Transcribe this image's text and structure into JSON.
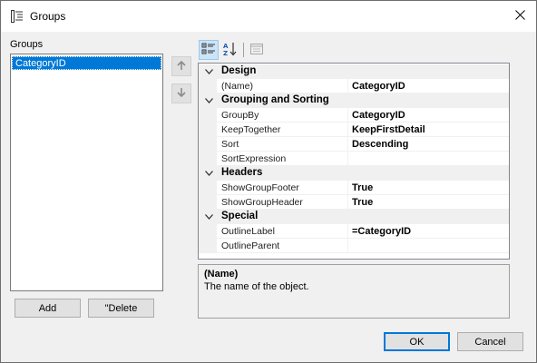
{
  "window": {
    "title": "Groups"
  },
  "groups_panel": {
    "label": "Groups",
    "items": [
      "CategoryID"
    ]
  },
  "buttons": {
    "add": "Add",
    "delete": "\"Delete",
    "ok": "OK",
    "cancel": "Cancel"
  },
  "property_grid": {
    "categories": [
      {
        "name": "Design",
        "properties": [
          {
            "name": "(Name)",
            "value": "CategoryID"
          }
        ]
      },
      {
        "name": "Grouping and Sorting",
        "properties": [
          {
            "name": "GroupBy",
            "value": "CategoryID"
          },
          {
            "name": "KeepTogether",
            "value": "KeepFirstDetail"
          },
          {
            "name": "Sort",
            "value": "Descending"
          },
          {
            "name": "SortExpression",
            "value": ""
          }
        ]
      },
      {
        "name": "Headers",
        "properties": [
          {
            "name": "ShowGroupFooter",
            "value": "True"
          },
          {
            "name": "ShowGroupHeader",
            "value": "True"
          }
        ]
      },
      {
        "name": "Special",
        "properties": [
          {
            "name": "OutlineLabel",
            "value": "=CategoryID"
          },
          {
            "name": "OutlineParent",
            "value": ""
          }
        ]
      }
    ]
  },
  "description": {
    "title": "(Name)",
    "text": "The name of the object."
  },
  "colors": {
    "selection": "#0078d7",
    "window_bg": "#f0f0f0"
  },
  "icons": {
    "title": "groups-icon",
    "close": "close-icon",
    "move_up": "arrow-up-icon",
    "move_down": "arrow-down-icon",
    "categorized": "categorized-icon",
    "alphabetical": "sort-az-icon",
    "property_pages": "property-pages-icon",
    "collapse": "chevron-down-icon"
  }
}
